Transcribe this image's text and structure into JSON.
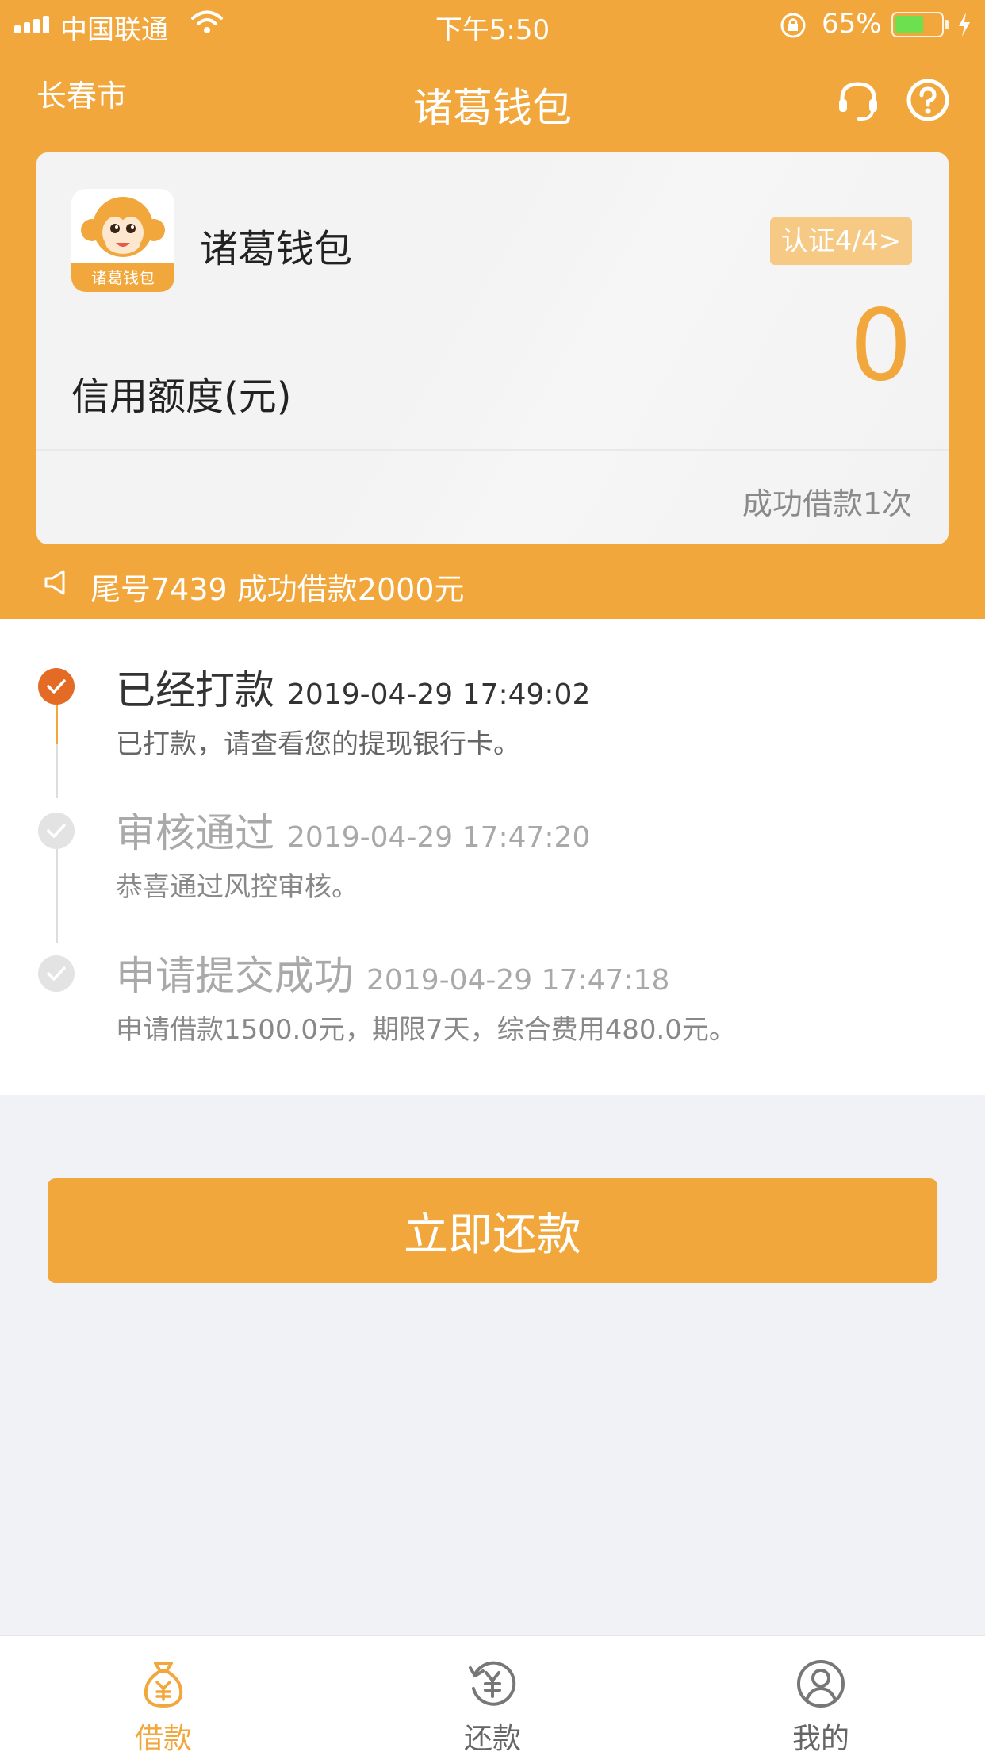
{
  "status_bar": {
    "carrier": "中国联通",
    "time": "下午5:50",
    "battery": "65%",
    "battery_level": 0.65
  },
  "nav": {
    "city": "长春市",
    "title": "诸葛钱包",
    "icons": [
      "headset-icon",
      "help-icon"
    ]
  },
  "card": {
    "logo_text": "诸葛钱包",
    "app_name": "诸葛钱包",
    "cert_badge": "认证4/4>",
    "limit_label": "信用额度(元)",
    "limit_amount": "0",
    "loan_count": "成功借款1次"
  },
  "notice": {
    "text": "尾号7439 成功借款2000元"
  },
  "timeline": [
    {
      "title": "已经打款",
      "time": "2019-04-29 17:49:02",
      "desc": "已打款，请查看您的提现银行卡。",
      "state": "active"
    },
    {
      "title": "审核通过",
      "time": "2019-04-29 17:47:20",
      "desc": "恭喜通过风控审核。",
      "state": "done"
    },
    {
      "title": "申请提交成功",
      "time": "2019-04-29 17:47:18",
      "desc": "申请借款1500.0元，期限7天，综合费用480.0元。",
      "state": "done"
    }
  ],
  "repay_button": "立即还款",
  "tabbar": {
    "items": [
      {
        "label": "借款",
        "icon": "money-bag-icon",
        "active": true
      },
      {
        "label": "还款",
        "icon": "repay-icon",
        "active": false
      },
      {
        "label": "我的",
        "icon": "profile-icon",
        "active": false
      }
    ]
  },
  "colors": {
    "brand_orange": "#f2a73c",
    "active_step": "#e36b26"
  }
}
